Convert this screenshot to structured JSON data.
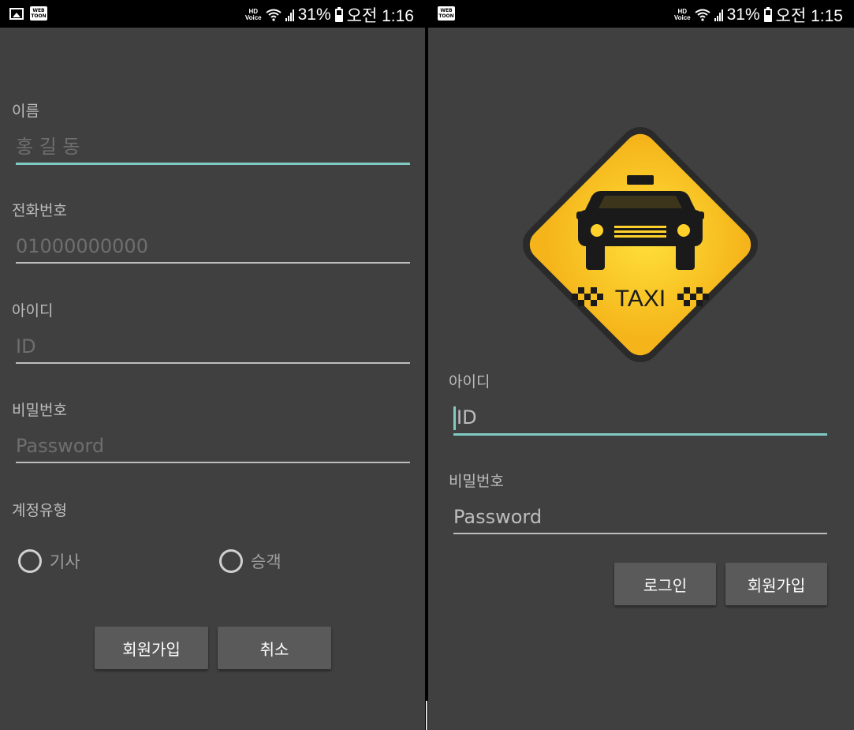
{
  "status_left": {
    "time": "오전 1:16",
    "battery": "31%",
    "hd_label": "HD",
    "voice_label": "Voice",
    "icons": [
      "gallery-icon",
      "webtoon-icon",
      "hd-voice-icon",
      "wifi-icon",
      "signal-icon",
      "battery-icon"
    ]
  },
  "status_right": {
    "time": "오전 1:15",
    "battery": "31%",
    "hd_label": "HD",
    "voice_label": "Voice",
    "icons": [
      "webtoon-icon",
      "hd-voice-icon",
      "wifi-icon",
      "signal-icon",
      "battery-icon"
    ]
  },
  "webtoon_text": "WEB TOON",
  "signup": {
    "name_label": "이름",
    "name_placeholder": "홍 길 동",
    "phone_label": "전화번호",
    "phone_placeholder": "01000000000",
    "id_label": "아이디",
    "id_placeholder": "ID",
    "pw_label": "비밀번호",
    "pw_placeholder": "Password",
    "type_label": "계정유형",
    "radio_driver": "기사",
    "radio_passenger": "승객",
    "signup_button": "회원가입",
    "cancel_button": "취소"
  },
  "login": {
    "logo_text": "TAXI",
    "id_label": "아이디",
    "id_placeholder": "ID",
    "pw_label": "비밀번호",
    "pw_placeholder": "Password",
    "login_button": "로그인",
    "signup_button": "회원가입"
  },
  "colors": {
    "background": "#404040",
    "accent": "#7fcbc4",
    "logo_yellow": "#f7c51e",
    "button": "#5a5a5a"
  }
}
